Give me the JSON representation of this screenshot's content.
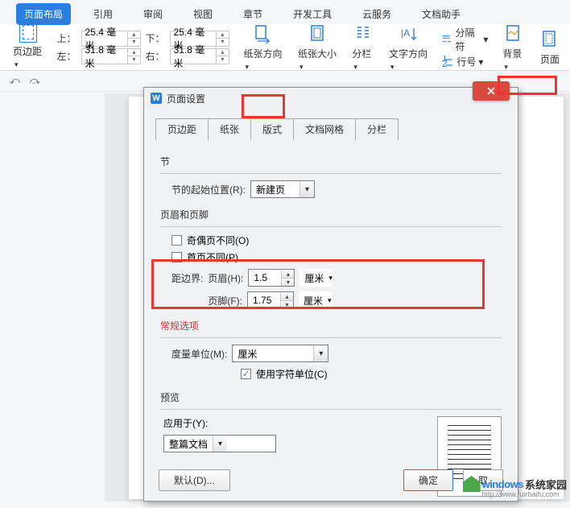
{
  "ribbon": {
    "tabs": [
      "页面布局",
      "引用",
      "审阅",
      "视图",
      "章节",
      "开发工具",
      "云服务",
      "文档助手"
    ],
    "margins_btn": "页边距",
    "margins": {
      "top_label": "上：",
      "top_value": "25.4 毫米",
      "bottom_label": "下：",
      "bottom_value": "25.4 毫米",
      "left_label": "左：",
      "left_value": "31.8 毫米",
      "right_label": "右：",
      "right_value": "31.8 毫米"
    },
    "tools": {
      "orientation": "纸张方向",
      "size": "纸张大小",
      "columns": "分栏",
      "text_dir": "文字方向",
      "breaks": "分隔符",
      "line_num": "行号",
      "background": "背景",
      "page_border": "页面"
    }
  },
  "dialog": {
    "title": "页面设置",
    "tabs": [
      "页边距",
      "纸张",
      "版式",
      "文档网格",
      "分栏"
    ],
    "section_label": "节",
    "section_start_label": "节的起始位置(R):",
    "section_start_value": "新建页",
    "hf_label": "页眉和页脚",
    "odd_even": "奇偶页不同(O)",
    "first_page": "首页不同(P)",
    "from_edge_label": "距边界:",
    "header_label": "页眉(H):",
    "header_value": "1.5",
    "footer_label": "页脚(F):",
    "footer_value": "1.75",
    "unit_cm": "厘米",
    "general_label": "常规选项",
    "measure_label": "度量单位(M):",
    "measure_value": "厘米",
    "char_unit": "使用字符单位(C)",
    "preview_label": "预览",
    "apply_label": "应用于(Y):",
    "apply_value": "整篇文档",
    "default_btn": "默认(D)...",
    "ok_btn": "确定",
    "cancel_btn": "取"
  },
  "watermark": {
    "brand1": "windows",
    "brand2": "系统家园",
    "url": "http://www.ruirhaifu.com"
  }
}
